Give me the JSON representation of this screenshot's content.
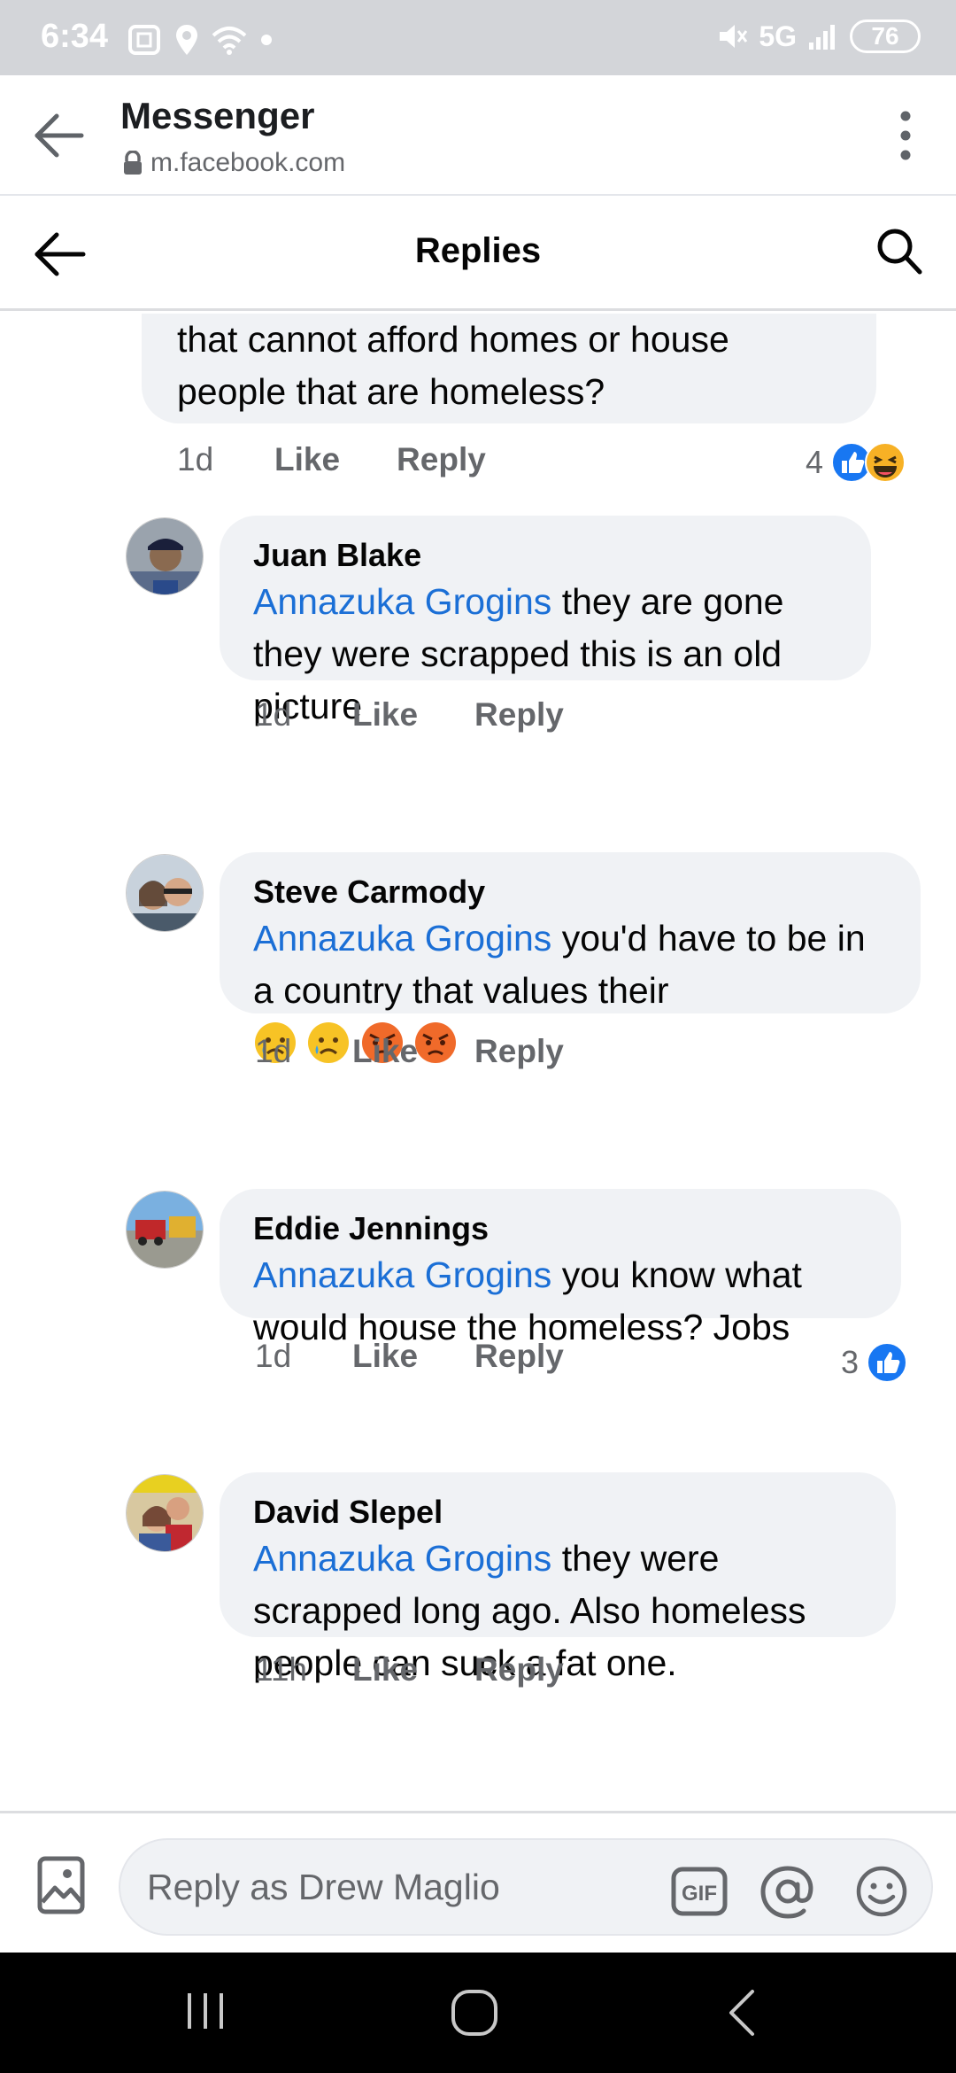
{
  "status_bar": {
    "time": "6:34",
    "network": "5G",
    "battery": "76"
  },
  "browser": {
    "title": "Messenger",
    "url": "m.facebook.com"
  },
  "header": {
    "title": "Replies"
  },
  "parent_comment": {
    "text_line1": "that cannot afford homes or house",
    "text_line2": "people that are homeless?",
    "time": "1d",
    "like_label": "Like",
    "reply_label": "Reply",
    "reaction_count": "4"
  },
  "replies": [
    {
      "author": "Juan Blake",
      "mention": "Annazuka Grogins",
      "text": " they are gone they were scrapped this is an old picture",
      "time": "1d",
      "like_label": "Like",
      "reply_label": "Reply"
    },
    {
      "author": "Steve Carmody",
      "mention": "Annazuka Grogins",
      "text": " you'd have to be in a country that values their",
      "time": "1d",
      "like_label": "Like",
      "reply_label": "Reply"
    },
    {
      "author": "Eddie Jennings",
      "mention": "Annazuka Grogins",
      "text": " you know what would house the homeless? Jobs",
      "time": "1d",
      "like_label": "Like",
      "reply_label": "Reply",
      "reaction_count": "3"
    },
    {
      "author": "David Slepel",
      "mention": "Annazuka Grogins",
      "text": " they were scrapped long ago. Also homeless people can suck a fat one.",
      "time": "11h",
      "like_label": "Like",
      "reply_label": "Reply"
    }
  ],
  "input": {
    "placeholder": "Reply as Drew Maglio",
    "gif_label": "GIF"
  },
  "colors": {
    "mention": "#1b6fd6",
    "bubble": "#f0f2f5",
    "like_blue": "#1877f2"
  }
}
